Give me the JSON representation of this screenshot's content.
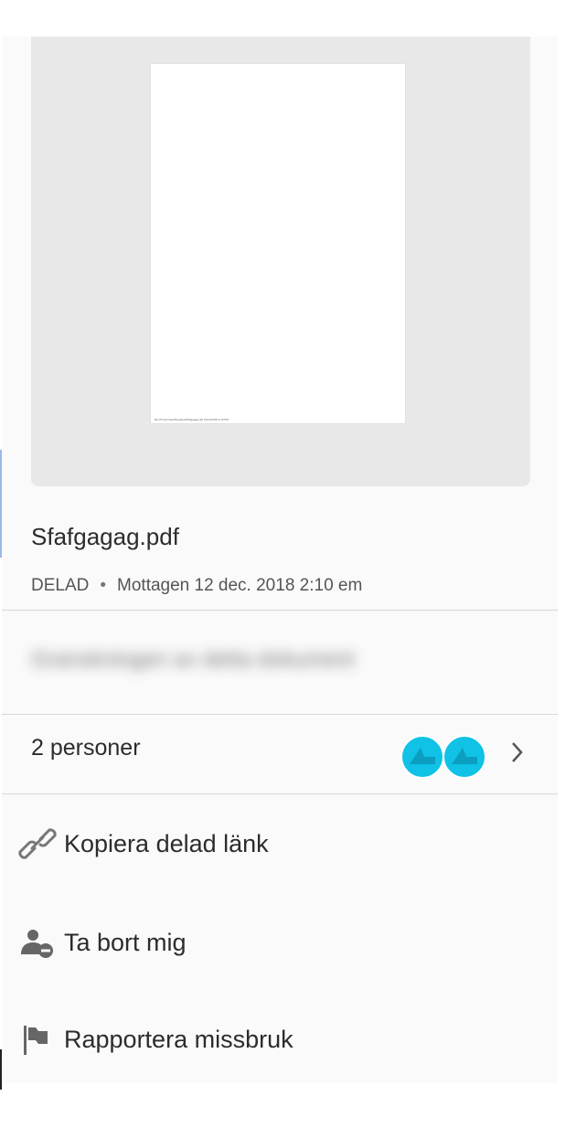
{
  "document": {
    "filename": "Sfafgagag.pdf",
    "status": "DELAD",
    "separator": "•",
    "received": "Mottagen 12 dec. 2018 2:10 em",
    "page_footer": "file:///Users/user/Desktop/Sfafgagag.pdf 12/12/2018 2:10 PM"
  },
  "blurred_text": "Granskningen av detta dokument",
  "participants": {
    "label": "2 personer",
    "avatar_color": "#0fc2e6"
  },
  "actions": [
    {
      "label": "Kopiera delad länk",
      "icon": "link-icon"
    },
    {
      "label": "Ta bort mig",
      "icon": "remove-user-icon"
    },
    {
      "label": "Rapportera missbruk",
      "icon": "flag-icon"
    }
  ]
}
